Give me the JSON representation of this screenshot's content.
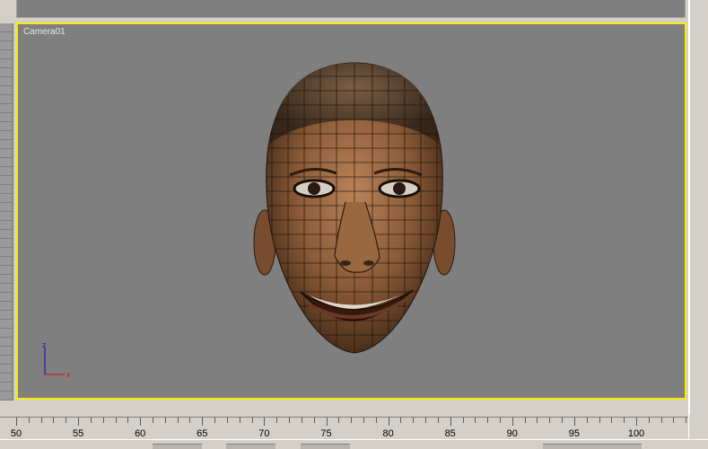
{
  "viewport": {
    "label": "Camera01",
    "border_color": "#f5f000",
    "background": "#7f7f7f"
  },
  "axis_gizmo": {
    "z_label": "z",
    "x_label": "x"
  },
  "timeline": {
    "labels": [
      "50",
      "55",
      "60",
      "65",
      "70",
      "75",
      "80",
      "85",
      "90",
      "95",
      "100"
    ]
  }
}
